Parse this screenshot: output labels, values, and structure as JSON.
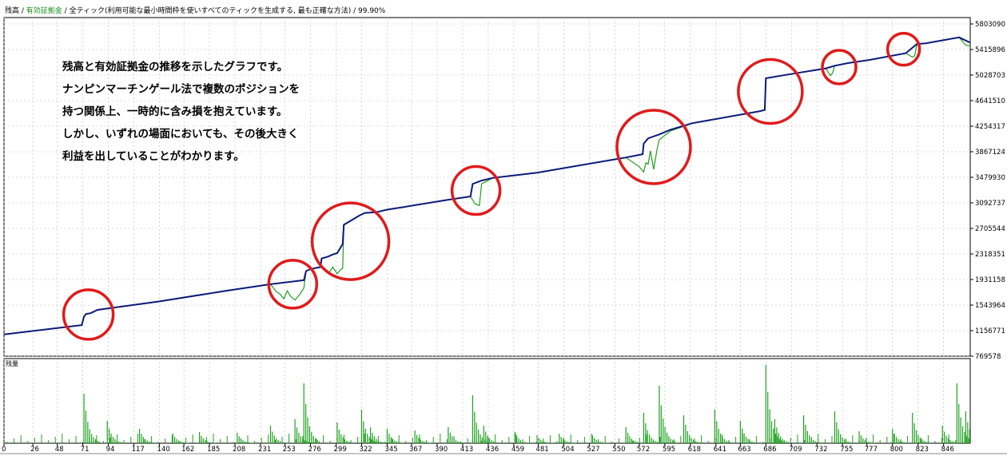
{
  "header": {
    "series1": "残高",
    "sep1": " / ",
    "series2": "有効証拠金",
    "sep2": " / ",
    "model": "全ティック(利用可能な最小時間枠を使いすべてのティックを生成する, 最も正確な方法)",
    "sep3": " / ",
    "quality": "99.90%"
  },
  "annotation": [
    "残高と有効証拠金の推移を示したグラフです。",
    "ナンピンマーチンゲール法で複数のポジションを",
    "持つ関係上、一時的に含み損を抱えています。",
    "しかし、いずれの場面においても、その後大きく",
    "利益を出していることがわかります。"
  ],
  "volume_label": "残量",
  "colors": {
    "balance": "#0a1a7a",
    "equity": "#1fa01f",
    "volume": "#1fa01f",
    "circle": "#e01b1b",
    "grid": "#b8b8b8"
  },
  "chart_data": {
    "type": "line",
    "title": "",
    "xlabel": "",
    "ylabel": "",
    "grid": true,
    "ylim": [
      769578,
      5900000
    ],
    "y_ticks": [
      "5803090",
      "5415896",
      "5028703",
      "4641510",
      "4254317",
      "3867124",
      "3479930",
      "3092737",
      "2705544",
      "2318351",
      "1931158",
      "1543964",
      "1156771",
      "769578"
    ],
    "x_ticks": [
      "0",
      "26",
      "48",
      "71",
      "94",
      "117",
      "140",
      "162",
      "185",
      "208",
      "231",
      "253",
      "276",
      "299",
      "322",
      "345",
      "367",
      "390",
      "413",
      "436",
      "459",
      "481",
      "504",
      "527",
      "550",
      "572",
      "595",
      "618",
      "641",
      "663",
      "686",
      "709",
      "732",
      "755",
      "777",
      "800",
      "823",
      "846"
    ],
    "x_range": [
      0,
      870
    ],
    "series": [
      {
        "name": "残高",
        "x": [
          0,
          70,
          72,
          74,
          78,
          84,
          92,
          140,
          200,
          240,
          270,
          272,
          276,
          285,
          286,
          292,
          296,
          300,
          305,
          306,
          320,
          325,
          335,
          345,
          360,
          400,
          420,
          422,
          430,
          440,
          480,
          560,
          575,
          576,
          580,
          590,
          600,
          620,
          680,
          685,
          686,
          700,
          740,
          748,
          760,
          780,
          812,
          822,
          830,
          860,
          870
        ],
        "y": [
          1100000,
          1240000,
          1370000,
          1410000,
          1420000,
          1470000,
          1490000,
          1600000,
          1760000,
          1860000,
          1920000,
          2060000,
          2090000,
          2120000,
          2250000,
          2280000,
          2310000,
          2330000,
          2470000,
          2760000,
          2900000,
          2940000,
          2950000,
          2990000,
          3030000,
          3140000,
          3190000,
          3380000,
          3430000,
          3470000,
          3550000,
          3780000,
          3830000,
          3990000,
          4070000,
          4130000,
          4200000,
          4300000,
          4480000,
          4500000,
          4980000,
          5020000,
          5130000,
          5170000,
          5210000,
          5260000,
          5360000,
          5500000,
          5510000,
          5600000,
          5520000
        ]
      },
      {
        "name": "有効証拠金",
        "x": [
          0,
          70,
          72,
          74,
          78,
          84,
          92,
          140,
          200,
          240,
          245,
          248,
          252,
          255,
          258,
          262,
          266,
          270,
          272,
          276,
          285,
          290,
          293,
          296,
          300,
          303,
          305,
          306,
          320,
          325,
          335,
          345,
          360,
          400,
          420,
          424,
          428,
          430,
          440,
          480,
          560,
          572,
          576,
          578,
          580,
          582,
          585,
          588,
          590,
          600,
          620,
          680,
          685,
          686,
          700,
          740,
          744,
          746,
          748,
          760,
          780,
          812,
          818,
          820,
          822,
          830,
          860,
          866,
          870
        ],
        "y": [
          1100000,
          1240000,
          1370000,
          1410000,
          1420000,
          1470000,
          1490000,
          1600000,
          1760000,
          1860000,
          1750000,
          1720000,
          1640000,
          1760000,
          1680000,
          1620000,
          1700000,
          1800000,
          2060000,
          2090000,
          2120000,
          2080000,
          2040000,
          2120000,
          2020000,
          2080000,
          2100000,
          2760000,
          2900000,
          2940000,
          2950000,
          2990000,
          3030000,
          3140000,
          3190000,
          3080000,
          3050000,
          3380000,
          3470000,
          3550000,
          3780000,
          3640000,
          3560000,
          3700000,
          3680000,
          3880000,
          3600000,
          3900000,
          4050000,
          4180000,
          4300000,
          4480000,
          4500000,
          4980000,
          5020000,
          5130000,
          5020000,
          5060000,
          5170000,
          5210000,
          5260000,
          5360000,
          5300000,
          5320000,
          5500000,
          5510000,
          5600000,
          5480000,
          5470000
        ]
      }
    ],
    "volume_spikes": [
      {
        "x": 72,
        "v": 0.62
      },
      {
        "x": 93,
        "v": 0.28
      },
      {
        "x": 122,
        "v": 0.18
      },
      {
        "x": 152,
        "v": 0.12
      },
      {
        "x": 176,
        "v": 0.14
      },
      {
        "x": 210,
        "v": 0.13
      },
      {
        "x": 240,
        "v": 0.22
      },
      {
        "x": 262,
        "v": 0.3
      },
      {
        "x": 270,
        "v": 0.75
      },
      {
        "x": 300,
        "v": 0.26
      },
      {
        "x": 322,
        "v": 0.42
      },
      {
        "x": 330,
        "v": 0.2
      },
      {
        "x": 345,
        "v": 0.18
      },
      {
        "x": 370,
        "v": 0.16
      },
      {
        "x": 400,
        "v": 0.2
      },
      {
        "x": 422,
        "v": 0.6
      },
      {
        "x": 432,
        "v": 0.22
      },
      {
        "x": 460,
        "v": 0.14
      },
      {
        "x": 480,
        "v": 0.1
      },
      {
        "x": 500,
        "v": 0.12
      },
      {
        "x": 530,
        "v": 0.1
      },
      {
        "x": 560,
        "v": 0.2
      },
      {
        "x": 576,
        "v": 0.38
      },
      {
        "x": 590,
        "v": 0.72
      },
      {
        "x": 612,
        "v": 0.35
      },
      {
        "x": 640,
        "v": 0.42
      },
      {
        "x": 663,
        "v": 0.28
      },
      {
        "x": 686,
        "v": 0.98
      },
      {
        "x": 694,
        "v": 0.3
      },
      {
        "x": 720,
        "v": 0.35
      },
      {
        "x": 748,
        "v": 0.4
      },
      {
        "x": 770,
        "v": 0.15
      },
      {
        "x": 800,
        "v": 0.18
      },
      {
        "x": 818,
        "v": 0.38
      },
      {
        "x": 845,
        "v": 0.22
      },
      {
        "x": 858,
        "v": 0.75
      },
      {
        "x": 866,
        "v": 0.4
      }
    ],
    "highlight_circles": [
      {
        "x": 76,
        "y": 1400000,
        "r": 31
      },
      {
        "x": 260,
        "y": 1860000,
        "r": 30
      },
      {
        "x": 312,
        "y": 2510000,
        "r": 48
      },
      {
        "x": 425,
        "y": 3280000,
        "r": 30
      },
      {
        "x": 585,
        "y": 3940000,
        "r": 46
      },
      {
        "x": 690,
        "y": 4780000,
        "r": 40
      },
      {
        "x": 752,
        "y": 5150000,
        "r": 21
      },
      {
        "x": 810,
        "y": 5420000,
        "r": 20
      }
    ]
  }
}
